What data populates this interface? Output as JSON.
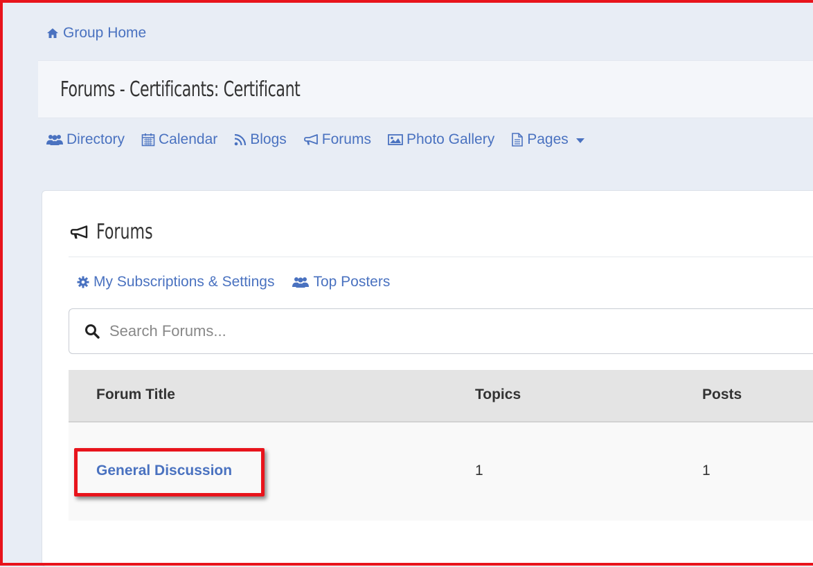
{
  "breadcrumb": {
    "label": "Group Home",
    "icon": "home-icon"
  },
  "page_title": "Forums - Certificants: Certificant",
  "nav": {
    "items": [
      {
        "label": "Directory",
        "icon": "users-icon"
      },
      {
        "label": "Calendar",
        "icon": "calendar-icon"
      },
      {
        "label": "Blogs",
        "icon": "rss-icon"
      },
      {
        "label": "Forums",
        "icon": "bullhorn-icon"
      },
      {
        "label": "Photo Gallery",
        "icon": "image-icon"
      },
      {
        "label": "Pages",
        "icon": "document-icon"
      }
    ]
  },
  "forums_card": {
    "title": "Forums",
    "sublinks": [
      {
        "label": "My Subscriptions & Settings",
        "icon": "gear-icon"
      },
      {
        "label": "Top Posters",
        "icon": "users-icon"
      }
    ],
    "search": {
      "placeholder": "Search Forums..."
    },
    "table": {
      "headers": [
        "Forum Title",
        "Topics",
        "Posts"
      ],
      "rows": [
        {
          "title": "General Discussion",
          "topics": "1",
          "posts": "1"
        }
      ]
    }
  },
  "colors": {
    "link": "#4a72c0",
    "highlight": "#e8141c",
    "background": "#e8edf5"
  }
}
